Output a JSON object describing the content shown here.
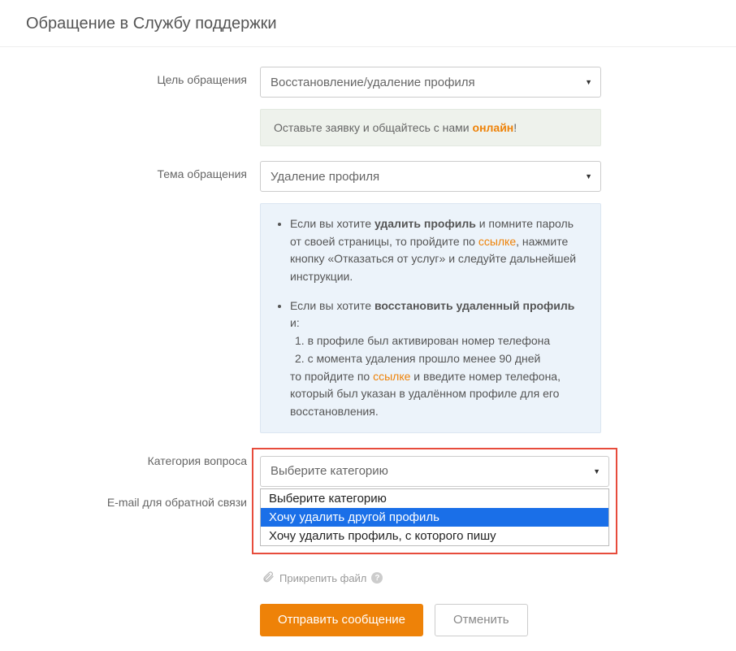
{
  "title": "Обращение в Службу поддержки",
  "labels": {
    "purpose": "Цель обращения",
    "topic": "Тема обращения",
    "category": "Категория вопроса",
    "email": "E-mail для обратной связи"
  },
  "purpose": {
    "value": "Восстановление/удаление профиля"
  },
  "notice": {
    "prefix": "Оставьте заявку и общайтесь с нами ",
    "highlight": "онлайн",
    "suffix": "!"
  },
  "topic": {
    "value": "Удаление профиля"
  },
  "info": {
    "item1_pre": "Если вы хотите ",
    "item1_bold": "удалить профиль",
    "item1_mid": " и помните пароль от своей страницы, то пройдите по ",
    "item1_link": "ссылке",
    "item1_post": ", нажмите кнопку «Отказаться от услуг» и следуйте дальнейшей инструкции.",
    "item2_pre": "Если вы хотите ",
    "item2_bold": "восстановить удаленный профиль",
    "item2_post": " и:",
    "item2_n1": "1. в профиле был активирован номер телефона",
    "item2_n2": "2. с момента удаления прошло менее 90 дней",
    "item2_tail_pre": "то пройдите по ",
    "item2_tail_link": "ссылке",
    "item2_tail_post": " и введите номер телефона, который был указан в удалённом профиле для его восстановления."
  },
  "category": {
    "placeholder": "Выберите категорию",
    "options": {
      "opt0": "Выберите категорию",
      "opt1": "Хочу удалить другой профиль",
      "opt2": "Хочу удалить профиль, с которого пишу"
    }
  },
  "attach": {
    "label": "Прикрепить файл"
  },
  "buttons": {
    "submit": "Отправить сообщение",
    "cancel": "Отменить"
  }
}
